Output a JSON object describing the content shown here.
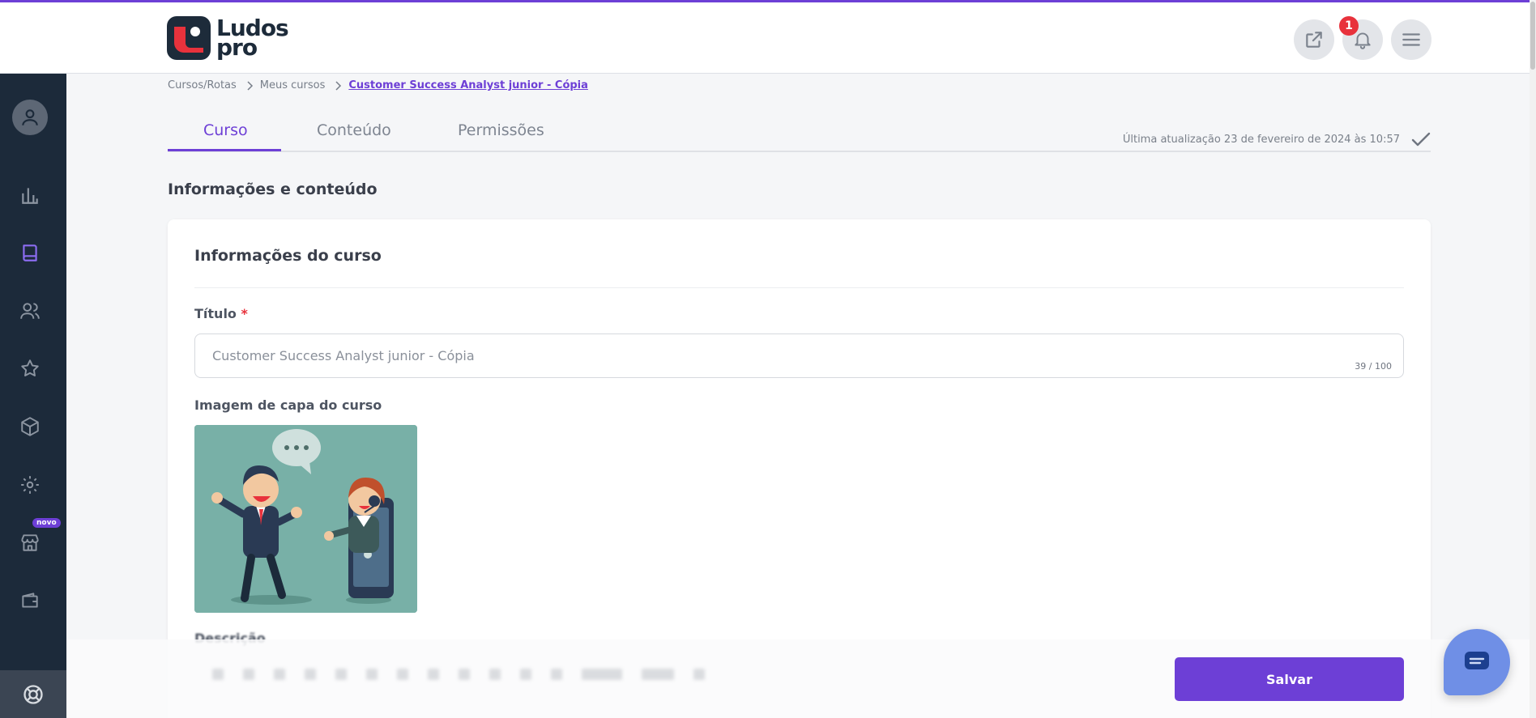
{
  "app": {
    "brand": "Ludos pro",
    "brand_line1": "Ludos",
    "brand_line2": "pro",
    "accent_color": "#6d3fd6",
    "sidebar_color": "#1c2a3a"
  },
  "header": {
    "external_link_icon": "external-link-icon",
    "notifications_count": "1",
    "menu_icon": "hamburger-menu-icon"
  },
  "sidebar": {
    "items": [
      {
        "icon": "user-avatar-icon"
      },
      {
        "icon": "bar-chart-icon"
      },
      {
        "icon": "book-icon",
        "active": true
      },
      {
        "icon": "users-icon"
      },
      {
        "icon": "star-icon"
      },
      {
        "icon": "box-icon"
      },
      {
        "icon": "gear-icon"
      },
      {
        "icon": "store-icon",
        "badge": "novo"
      },
      {
        "icon": "wallet-icon"
      },
      {
        "icon": "help-lifebuoy-icon"
      }
    ],
    "novo_badge": "novo"
  },
  "breadcrumb": {
    "items": [
      "Cursos/Rotas",
      "Meus cursos"
    ],
    "current": "Customer Success Analyst junior - Cópia"
  },
  "tabs": {
    "items": [
      "Curso",
      "Conteúdo",
      "Permissões"
    ],
    "active": "Curso",
    "last_updated": "Última atualização 23 de fevereiro de 2024 às 10:57"
  },
  "main": {
    "section_title": "Informações e conteúdo",
    "card_title": "Informações do curso",
    "title_label": "Título",
    "required_mark": "*",
    "title_value": "Customer Success Analyst junior - Cópia",
    "title_counter": "39 / 100",
    "cover_label": "Imagem de capa do curso",
    "description_label": "Descrição"
  },
  "footer": {
    "save_label": "Salvar",
    "chat_icon": "chat-bubble-icon"
  }
}
